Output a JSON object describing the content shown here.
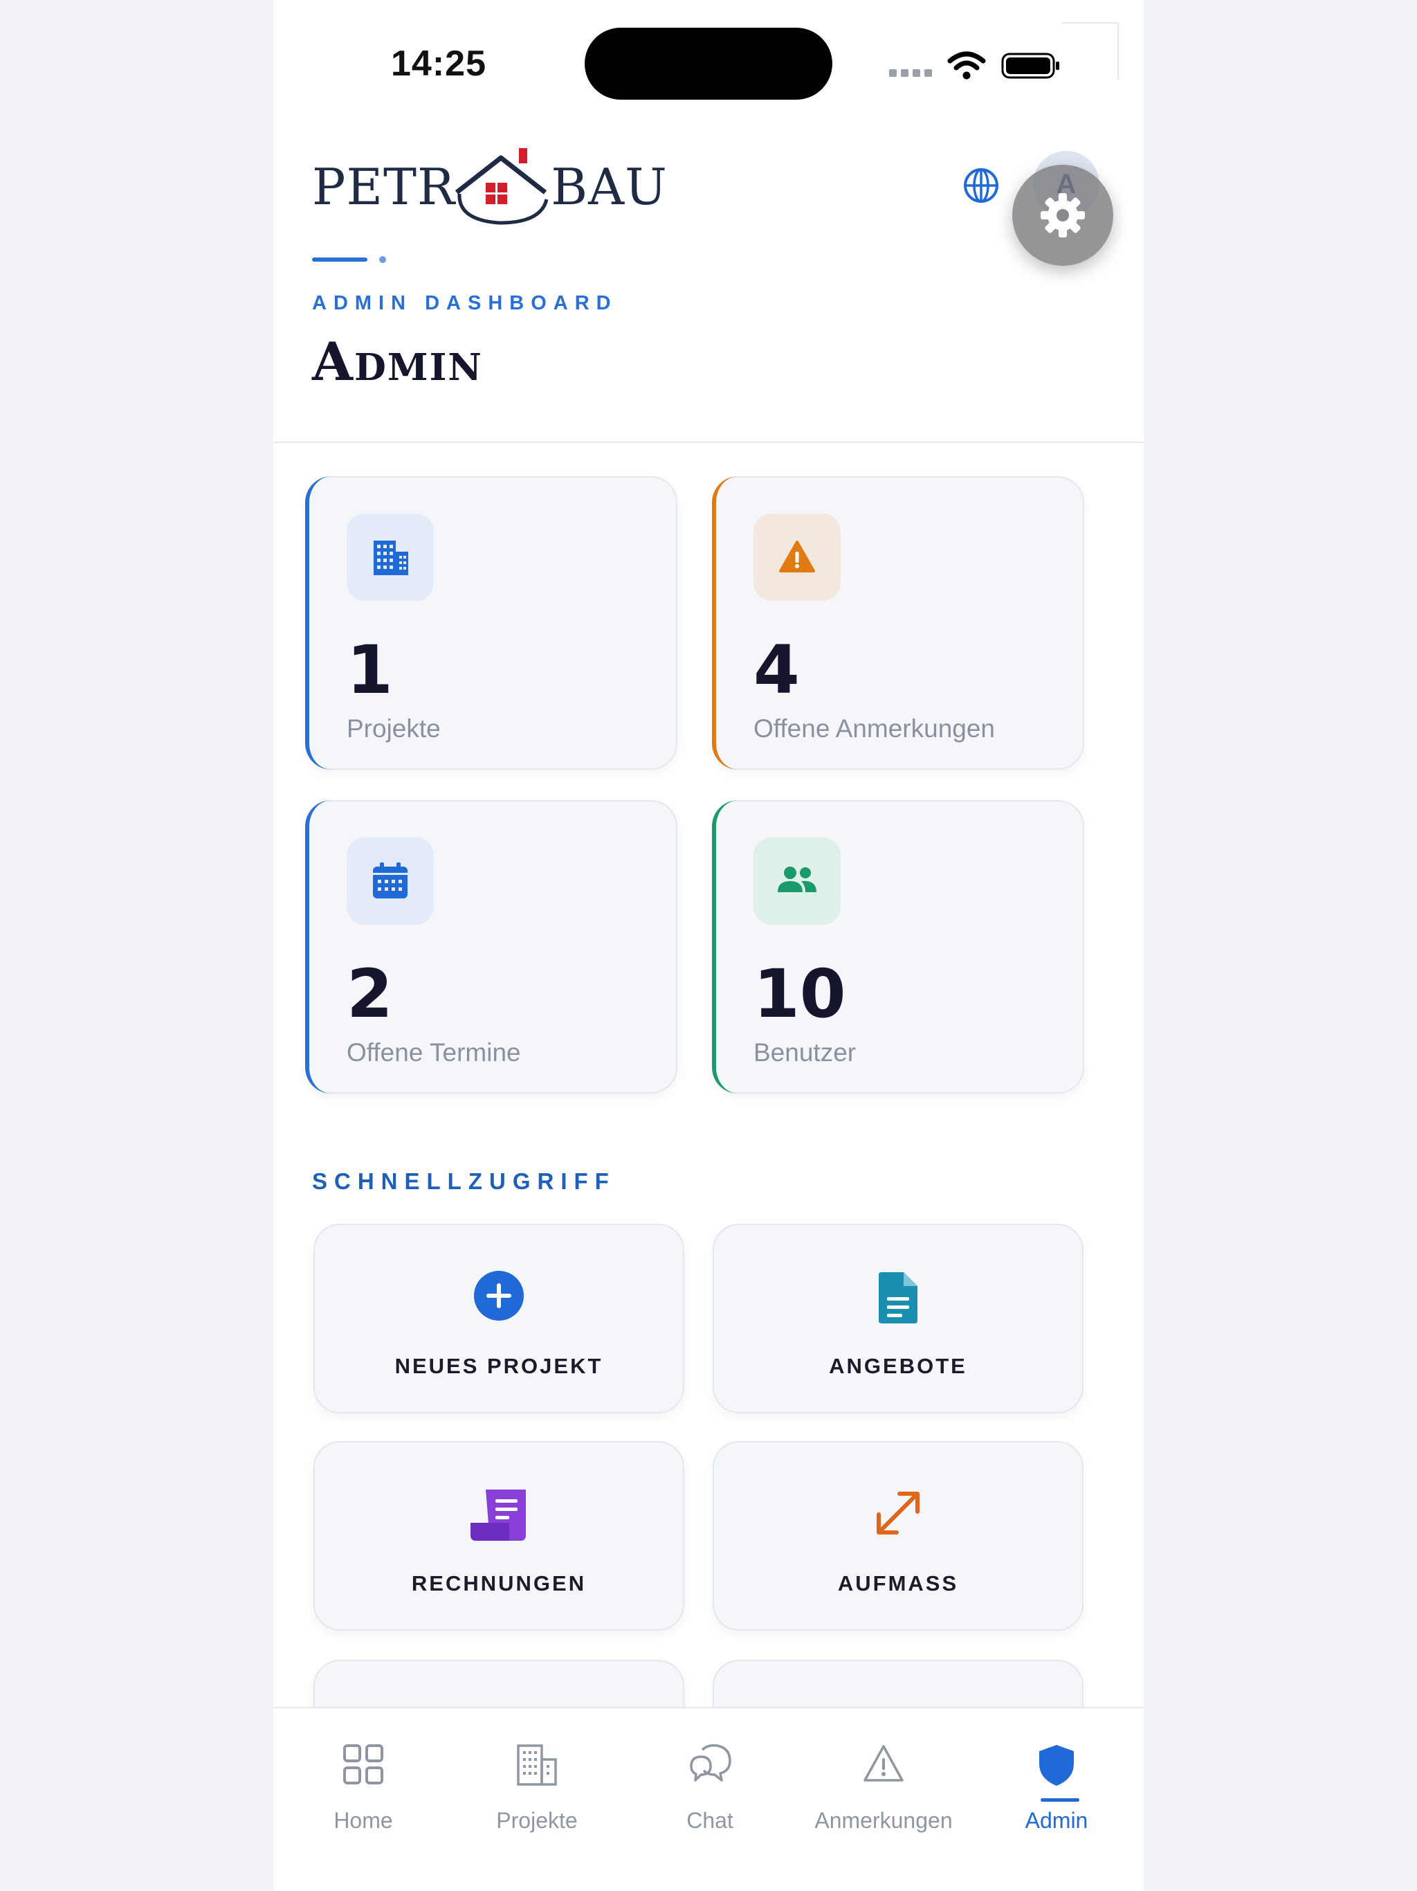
{
  "status_bar": {
    "time": "14:25"
  },
  "brand": {
    "logo_left": "PETR",
    "logo_right": "BAU"
  },
  "header": {
    "eyebrow": "ADMIN DASHBOARD",
    "title": "Admin",
    "avatar_initial": "A",
    "globe_icon": "globe-icon",
    "settings_icon": "gear-icon"
  },
  "stats": [
    {
      "value": "1",
      "label": "Projekte",
      "icon": "building-icon",
      "accent": "#2a6fd6",
      "icon_bg": "#e3ebf8"
    },
    {
      "value": "4",
      "label": "Offene Anmerkungen",
      "icon": "warning-icon",
      "accent": "#e07a12",
      "icon_bg": "#f3e8df"
    },
    {
      "value": "2",
      "label": "Offene Termine",
      "icon": "calendar-icon",
      "accent": "#2a6fd6",
      "icon_bg": "#e3ebf8"
    },
    {
      "value": "10",
      "label": "Benutzer",
      "icon": "users-icon",
      "accent": "#1a9a6a",
      "icon_bg": "#dff0ea"
    }
  ],
  "quick_access": {
    "title": "SCHNELLZUGRIFF",
    "items": [
      {
        "label": "NEUES PROJEKT",
        "icon": "plus-circle-icon",
        "color": "#1f6ad6"
      },
      {
        "label": "ANGEBOTE",
        "icon": "document-icon",
        "color": "#1b8fb0"
      },
      {
        "label": "RECHNUNGEN",
        "icon": "receipt-icon",
        "color": "#8b3fd9"
      },
      {
        "label": "AUFMASS",
        "icon": "resize-arrows-icon",
        "color": "#e0661c"
      }
    ]
  },
  "nav": {
    "items": [
      {
        "label": "Home",
        "icon": "grid-icon"
      },
      {
        "label": "Projekte",
        "icon": "building-icon"
      },
      {
        "label": "Chat",
        "icon": "chat-icon"
      },
      {
        "label": "Anmerkungen",
        "icon": "warning-icon"
      },
      {
        "label": "Admin",
        "icon": "shield-icon"
      }
    ],
    "active": "Admin"
  }
}
